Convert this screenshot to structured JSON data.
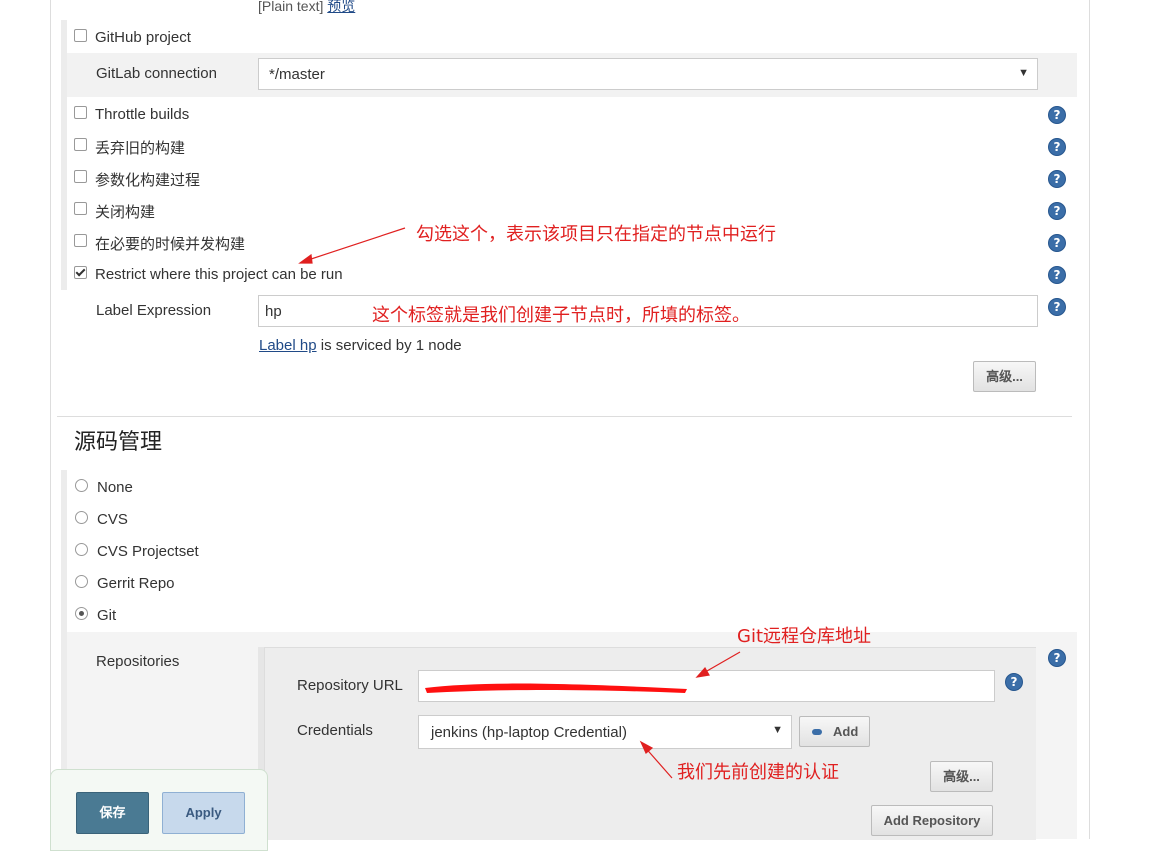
{
  "top_partial": {
    "text": "[Plain text]",
    "link": "预览"
  },
  "github_project": "GitHub project",
  "gitlab": {
    "label": "GitLab connection",
    "value": "*/master"
  },
  "options": [
    {
      "label": "Throttle builds",
      "checked": false
    },
    {
      "label": "丢弃旧的构建",
      "checked": false
    },
    {
      "label": "参数化构建过程",
      "checked": false
    },
    {
      "label": "关闭构建",
      "checked": false
    },
    {
      "label": "在必要的时候并发构建",
      "checked": false
    },
    {
      "label": "Restrict where this project can be run",
      "checked": true
    }
  ],
  "label_expression": {
    "label": "Label Expression",
    "value": "hp",
    "info_link": "Label hp",
    "info_text": " is serviced by 1 node"
  },
  "advanced_button": "高级...",
  "scm": {
    "title": "源码管理",
    "options": [
      {
        "label": "None",
        "selected": false
      },
      {
        "label": "CVS",
        "selected": false
      },
      {
        "label": "CVS Projectset",
        "selected": false
      },
      {
        "label": "Gerrit Repo",
        "selected": false
      },
      {
        "label": "Git",
        "selected": true
      }
    ]
  },
  "repositories": {
    "label": "Repositories",
    "repo_url_label": "Repository URL",
    "credentials_label": "Credentials",
    "credentials_value": "jenkins (hp-laptop Credential)",
    "add_button": "Add",
    "advanced_button": "高级...",
    "add_repository_button": "Add Repository"
  },
  "footer": {
    "save": "保存",
    "apply": "Apply"
  },
  "annotations": {
    "restrict_note": "勾选这个，表示该项目只在指定的节点中运行",
    "label_note": "这个标签就是我们创建子节点时，所填的标签。",
    "git_note": "Git远程仓库地址",
    "cred_note": "我们先前创建的认证"
  },
  "colors": {
    "annotation": "#e02020",
    "help_icon": "#3b6ea8",
    "save_button": "#4a7a93"
  }
}
